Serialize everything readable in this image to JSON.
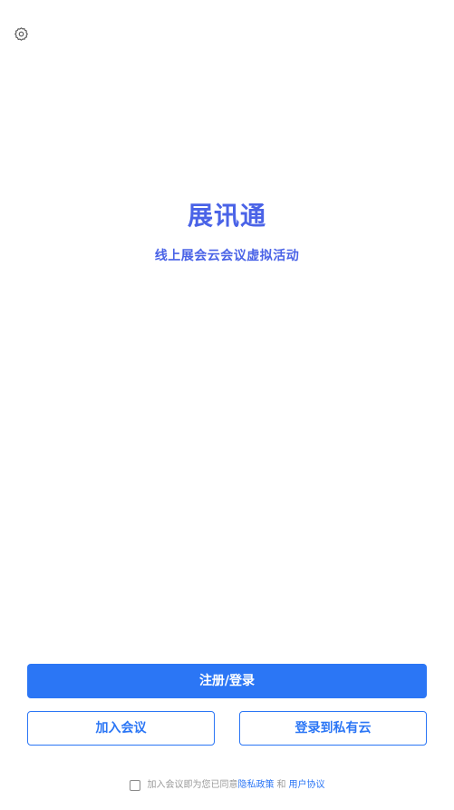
{
  "header": {
    "settings_icon": "gear-icon"
  },
  "brand": {
    "title": "展讯通",
    "subtitle": "线上展会云会议虚拟活动"
  },
  "actions": {
    "register_login": "注册/登录",
    "join_meeting": "加入会议",
    "private_cloud_login": "登录到私有云"
  },
  "agreement": {
    "checked": false,
    "prefix": "加入会议即为您已同意",
    "privacy_policy": "隐私政策",
    "and": "和",
    "user_agreement": "用户协议"
  },
  "colors": {
    "accent": "#2b76f5",
    "brand_text": "#4a63e7",
    "muted_text": "#9a9a9a"
  }
}
